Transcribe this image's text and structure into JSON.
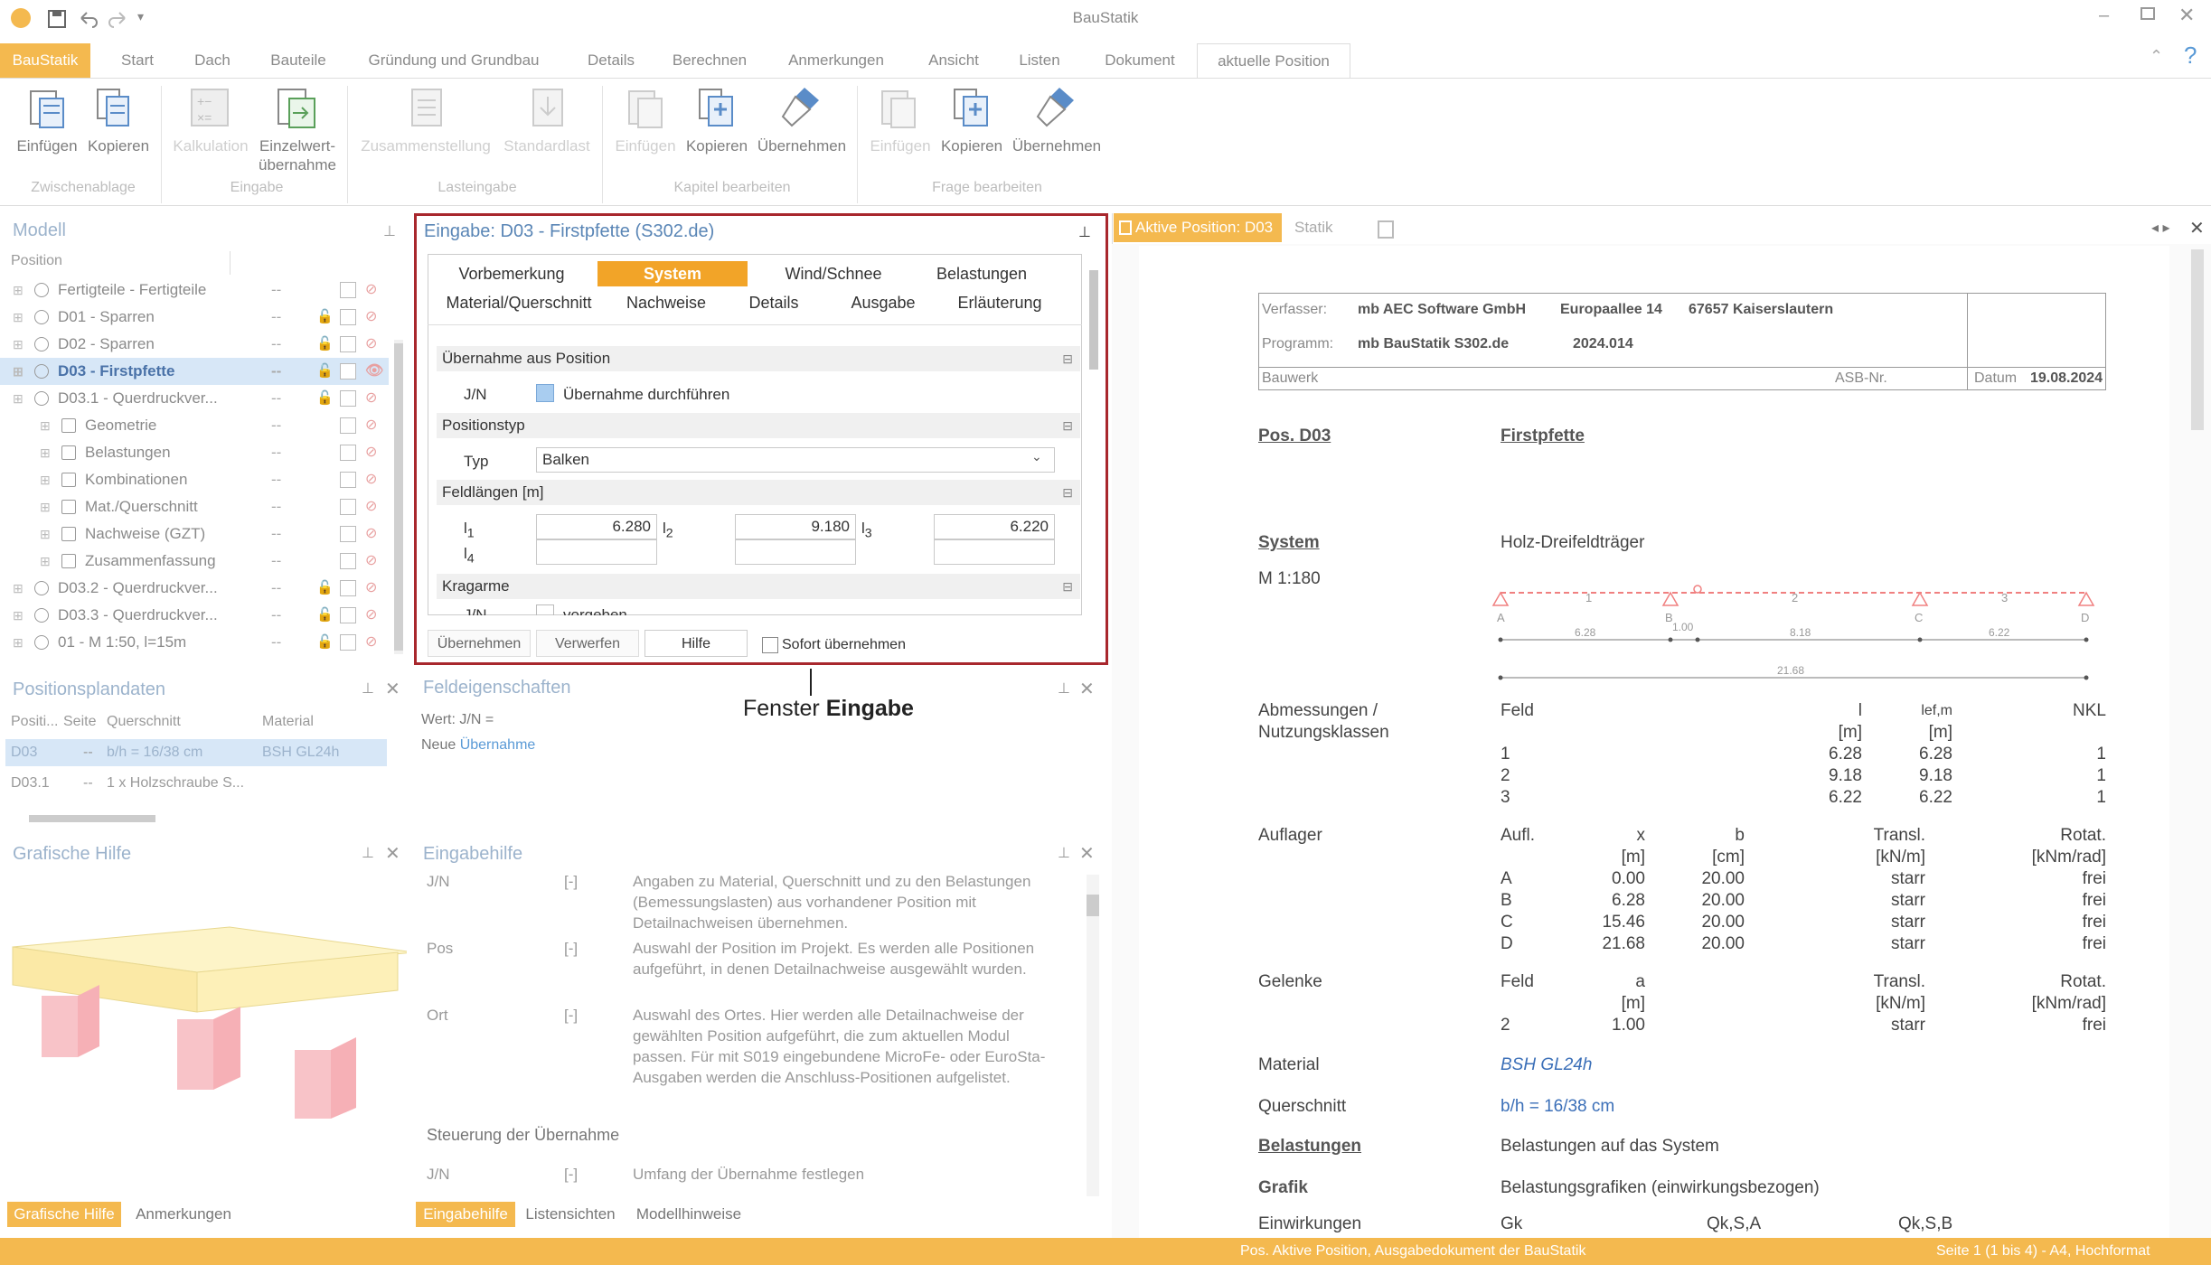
{
  "window": {
    "title": "BauStatik"
  },
  "ribbon_tabs": [
    "BauStatik",
    "Start",
    "Dach",
    "Bauteile",
    "Gründung und Grundbau",
    "Details",
    "Berechnen",
    "Anmerkungen",
    "Ansicht",
    "Listen",
    "Dokument",
    "aktuelle Position"
  ],
  "ribbon": {
    "buttons": [
      {
        "label": "Einfügen"
      },
      {
        "label": "Kopieren"
      },
      {
        "label": "Kalkulation"
      },
      {
        "label": "Einzelwert-\nübernahme"
      },
      {
        "label": "Zusammenstellung"
      },
      {
        "label": "Standardlast"
      },
      {
        "label": "Einfügen"
      },
      {
        "label": "Kopieren"
      },
      {
        "label": "Übernehmen"
      },
      {
        "label": "Einfügen"
      },
      {
        "label": "Kopieren"
      },
      {
        "label": "Übernehmen"
      }
    ],
    "groups": [
      "Zwischenablage",
      "Eingabe",
      "Lasteingabe",
      "Kapitel bearbeiten",
      "Frage bearbeiten"
    ]
  },
  "modell": {
    "title": "Modell",
    "col": "Position",
    "rows": [
      {
        "label": "Fertigteile - Fertigteile",
        "dash": "--"
      },
      {
        "label": "D01 - Sparren",
        "dash": "--"
      },
      {
        "label": "D02 - Sparren",
        "dash": "--"
      },
      {
        "label": "D03 - Firstpfette",
        "dash": "--"
      },
      {
        "label": "D03.1 - Querdruckver...",
        "dash": "--"
      },
      {
        "label": "Geometrie",
        "dash": "--"
      },
      {
        "label": "Belastungen",
        "dash": "--"
      },
      {
        "label": "Kombinationen",
        "dash": "--"
      },
      {
        "label": "Mat./Querschnitt",
        "dash": "--"
      },
      {
        "label": "Nachweise (GZT)",
        "dash": "--"
      },
      {
        "label": "Zusammenfassung",
        "dash": "--"
      },
      {
        "label": "D03.2 - Querdruckver...",
        "dash": "--"
      },
      {
        "label": "D03.3 - Querdruckver...",
        "dash": "--"
      },
      {
        "label": "01 - M 1:50, l=15m",
        "dash": "--"
      }
    ]
  },
  "positionsplan": {
    "title": "Positionsplandaten",
    "headers": [
      "Positi...",
      "Seite",
      "Querschnitt",
      "Material"
    ],
    "rows": [
      [
        "D03",
        "--",
        "b/h = 16/38 cm",
        "BSH GL24h"
      ],
      [
        "D03.1",
        "--",
        "1 x Holzschraube S...",
        ""
      ]
    ]
  },
  "grafische_hilfe": {
    "title": "Grafische Hilfe"
  },
  "eingabe": {
    "title": "Eingabe: D03 - Firstpfette (S302.de)",
    "tabs_row1": [
      "Vorbemerkung",
      "System",
      "Wind/Schnee",
      "Belastungen"
    ],
    "tabs_row2": [
      "Material/Querschnitt",
      "Nachweise",
      "Details",
      "Ausgabe",
      "Erläuterung"
    ],
    "sec1": "Übernahme aus Position",
    "sec1_label": "J/N",
    "sec1_check": "Übernahme durchführen",
    "sec2": "Positionstyp",
    "typ_label": "Typ",
    "typ_value": "Balken",
    "sec3": "Feldlängen [m]",
    "l1": "l",
    "l1s": "1",
    "l1v": "6.280",
    "l2": "l",
    "l2s": "2",
    "l2v": "9.180",
    "l3": "l",
    "l3s": "3",
    "l3v": "6.220",
    "l4": "l",
    "l4s": "4",
    "sec4": "Kragarme",
    "krag_label": "J/N",
    "krag_check": "vorgeben",
    "buttons": [
      "Übernehmen",
      "Verwerfen",
      "Hilfe"
    ],
    "sofort": "Sofort übernehmen"
  },
  "callout": {
    "text": "Fenster ",
    "bold": "Eingabe"
  },
  "feld": {
    "title": "Feldeigenschaften",
    "wert": "Wert: J/N =",
    "neue": "Neue ",
    "neue_link": "Übernahme"
  },
  "eingabehilfe": {
    "title": "Eingabehilfe",
    "rows": [
      {
        "k": "J/N",
        "u": "[-]",
        "t": "Angaben zu Material, Querschnitt und zu den Belastungen (Bemessungslasten) aus vorhandener Position mit Detailnachweisen übernehmen."
      },
      {
        "k": "Pos",
        "u": "[-]",
        "t": "Auswahl der Position im Projekt. Es werden alle Positionen aufgeführt, in denen Detailnachweise ausgewählt wurden."
      },
      {
        "k": "Ort",
        "u": "[-]",
        "t": "Auswahl des Ortes. Hier werden alle Detailnachweise der gewählten Position aufgeführt, die zum aktuellen Modul passen. Für mit S019 eingebundene MicroFe- oder EuroSta-Ausgaben werden die Anschluss-Positionen aufgelistet."
      }
    ],
    "steuerung": "Steuerung der Übernahme",
    "last_k": "J/N",
    "last_u": "[-]",
    "last_t": "Umfang der Übernahme festlegen"
  },
  "bottom_tabs_left": [
    "Grafische Hilfe",
    "Anmerkungen"
  ],
  "bottom_tabs_mid": [
    "Eingabehilfe",
    "Listensichten",
    "Modellhinweise"
  ],
  "doc_tabs": [
    "Aktive Position: D03",
    "Statik"
  ],
  "document": {
    "verfasser_l": "Verfasser:",
    "verfasser": "mb AEC Software GmbH",
    "addr1": "Europaallee 14",
    "addr2": "67657 Kaiserslautern",
    "programm_l": "Programm:",
    "programm": "mb BauStatik S302.de",
    "version": "2024.014",
    "bauwerk_l": "Bauwerk",
    "asb": "ASB-Nr.",
    "datum_l": "Datum",
    "datum": "19.08.2024",
    "pos_l": "Pos. D03",
    "pos_t": "Firstpfette",
    "system_l": "System",
    "system_t": "Holz-Dreifeldträger",
    "scale": "M 1:180",
    "sys_labels": {
      "A": "A",
      "B": "B",
      "C": "C",
      "D": "D",
      "f1": "1",
      "f2": "2",
      "f3": "3",
      "d1": "6.28",
      "d2": "1.00",
      "d3": "8.18",
      "d4": "6.22",
      "tot": "21.68"
    },
    "abm_l1": "Abmessungen /",
    "abm_l2": "Nutzungsklassen",
    "abm_h": [
      "Feld",
      "l",
      "lef,m",
      "NKL"
    ],
    "abm_u": [
      "",
      "[m]",
      "[m]",
      ""
    ],
    "abm_rows": [
      [
        "1",
        "6.28",
        "6.28",
        "1"
      ],
      [
        "2",
        "9.18",
        "9.18",
        "1"
      ],
      [
        "3",
        "6.22",
        "6.22",
        "1"
      ]
    ],
    "aufl_l": "Auflager",
    "aufl_h": [
      "Aufl.",
      "x",
      "b",
      "Transl.",
      "Rotat."
    ],
    "aufl_u": [
      "",
      "[m]",
      "[cm]",
      "[kN/m]",
      "[kNm/rad]"
    ],
    "aufl_rows": [
      [
        "A",
        "0.00",
        "20.00",
        "starr",
        "frei"
      ],
      [
        "B",
        "6.28",
        "20.00",
        "starr",
        "frei"
      ],
      [
        "C",
        "15.46",
        "20.00",
        "starr",
        "frei"
      ],
      [
        "D",
        "21.68",
        "20.00",
        "starr",
        "frei"
      ]
    ],
    "gel_l": "Gelenke",
    "gel_h": [
      "Feld",
      "a",
      "Transl.",
      "Rotat."
    ],
    "gel_u": [
      "",
      "[m]",
      "[kN/m]",
      "[kNm/rad]"
    ],
    "gel_rows": [
      [
        "2",
        "1.00",
        "starr",
        "frei"
      ]
    ],
    "mat_l": "Material",
    "mat_v": "BSH GL24h",
    "qs_l": "Querschnitt",
    "qs_v": "b/h = 16/38 cm",
    "bel_l": "Belastungen",
    "bel_v": "Belastungen auf das System",
    "gra_l": "Grafik",
    "gra_v": "Belastungsgrafiken (einwirkungsbezogen)",
    "einw_l": "Einwirkungen",
    "einw_h": [
      "Gk",
      "Qk,S,A",
      "Qk,S,B"
    ]
  },
  "statusbar": {
    "center": "Pos. Aktive Position, Ausgabedokument der BauStatik",
    "right": "Seite 1 (1 bis 4) - A4, Hochformat"
  },
  "colors": {
    "accent": "#f4b94f",
    "frame": "#a8272d",
    "panel_title": "#9cb3cc"
  }
}
